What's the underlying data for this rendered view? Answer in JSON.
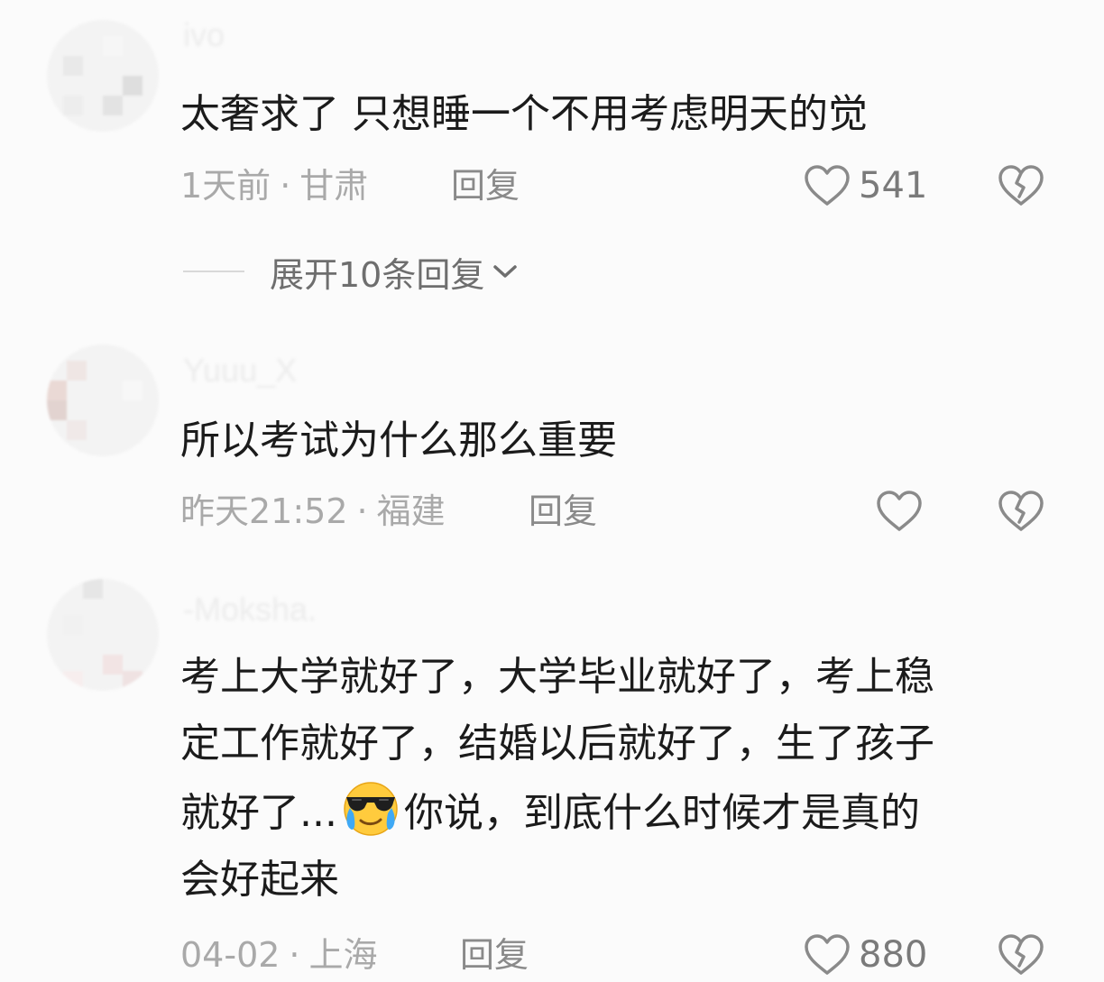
{
  "comments": [
    {
      "username": "ivo",
      "text_lines": [
        "太奢求了 只想睡一个不用考虑明天的觉"
      ],
      "time": "1天前",
      "location": "甘肃",
      "reply_label": "回复",
      "likes": "541",
      "expand_label": "展开10条回复"
    },
    {
      "username": "Yuuu_X",
      "text_lines": [
        "所以考试为什么那么重要"
      ],
      "time": "昨天21:52",
      "location": "福建",
      "reply_label": "回复",
      "likes": ""
    },
    {
      "username": "-Moksha.",
      "text_lines": [
        "考上大学就好了，大学毕业就好了，考上稳",
        "定工作就好了，结婚以后就好了，生了孩子",
        "就好了...",
        "你说，到底什么时候才是真的",
        "会好起来"
      ],
      "emoji": "crying-sunglasses-emoji",
      "time": "04-02",
      "location": "上海",
      "reply_label": "回复",
      "likes": "880"
    }
  ],
  "separator": "·",
  "colors": {
    "text": "#1b1b1b",
    "meta": "#a9a9a9",
    "icon": "#8a8a8a",
    "background": "#fbfbfb"
  }
}
